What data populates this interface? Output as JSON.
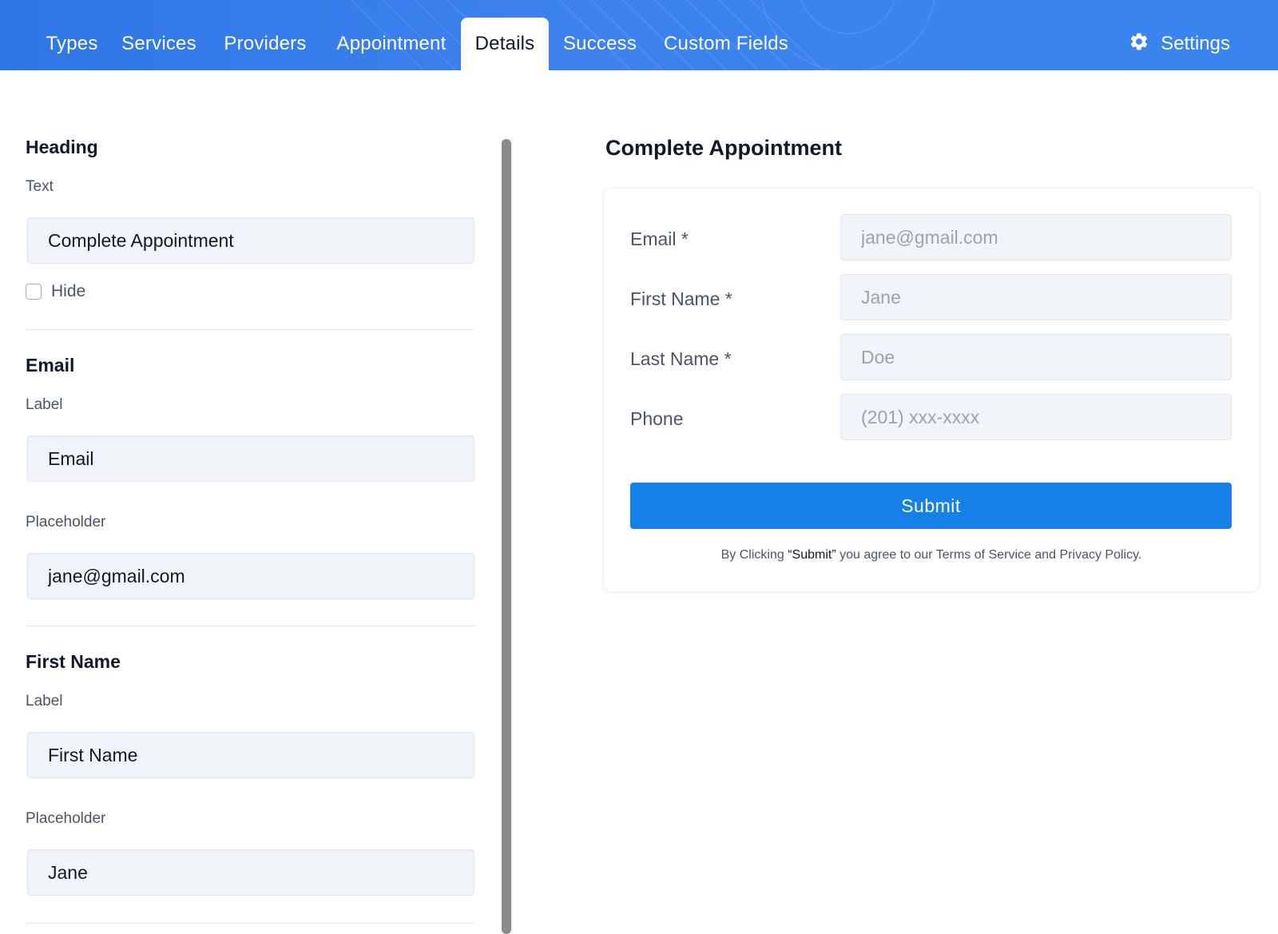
{
  "nav": {
    "tabs": [
      {
        "label": "Types"
      },
      {
        "label": "Services"
      },
      {
        "label": "Providers"
      },
      {
        "label": "Appointment"
      },
      {
        "label": "Details"
      },
      {
        "label": "Success"
      },
      {
        "label": "Custom Fields"
      }
    ],
    "active_tab": "Details",
    "settings_label": "Settings",
    "settings_icon": "gear-icon"
  },
  "editor": {
    "heading": {
      "title": "Heading",
      "text_label": "Text",
      "text_value": "Complete Appointment",
      "hide_label": "Hide",
      "hide_checked": false
    },
    "email": {
      "title": "Email",
      "label_label": "Label",
      "label_value": "Email",
      "placeholder_label": "Placeholder",
      "placeholder_value": "jane@gmail.com"
    },
    "first_name": {
      "title": "First Name",
      "label_label": "Label",
      "label_value": "First Name",
      "placeholder_label": "Placeholder",
      "placeholder_value": "Jane"
    }
  },
  "preview": {
    "title": "Complete Appointment",
    "fields": [
      {
        "label": "Email *",
        "placeholder": "jane@gmail.com"
      },
      {
        "label": "First Name *",
        "placeholder": "Jane"
      },
      {
        "label": "Last Name *",
        "placeholder": "Doe"
      },
      {
        "label": "Phone",
        "placeholder": "(201) xxx-xxxx"
      }
    ],
    "submit_label": "Submit",
    "legal": {
      "prefix": "By Clicking ",
      "quoted": "“Submit”",
      "middle": " you agree to our ",
      "terms": "Terms of Service",
      "and": " and ",
      "privacy": "Privacy Policy",
      "suffix": "."
    }
  },
  "colors": {
    "nav_gradient_start": "#2f76e6",
    "nav_gradient_end": "#3a84f0",
    "submit_button": "#1580e8",
    "input_background": "#f1f4f8"
  }
}
